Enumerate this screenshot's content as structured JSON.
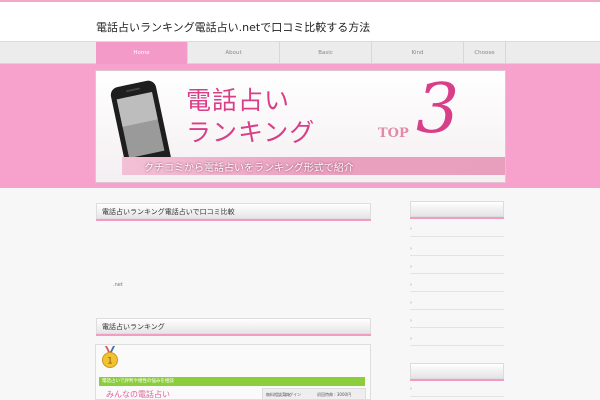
{
  "header": {
    "site_title": "電話占いランキング電話占い.netで口コミ比較する方法"
  },
  "nav": {
    "items": [
      {
        "label": "Home",
        "active": true
      },
      {
        "label": "About",
        "active": false
      },
      {
        "label": "Basic",
        "active": false
      },
      {
        "label": "Kind",
        "active": false
      },
      {
        "label": "Choose",
        "active": false
      }
    ]
  },
  "banner": {
    "title_line_1": "電話占い",
    "title_line_2": "ランキング",
    "top_label": "TOP",
    "top_number": "3",
    "subtitle": "クチコミから電話占いをランキング形式で紹介"
  },
  "main": {
    "section_1_title": "電話占いランキング電話占いで口コミ比較",
    "net_text": ".net",
    "section_2_title": "電話占いランキング",
    "ranking": {
      "green_bar_text": "電話占いで評判や相性の悩みを相談",
      "site_name": "みんなの電話占い",
      "detail_labels": [
        "無料相談案内",
        "ログイン",
        "初回特典 : 3000円"
      ]
    }
  },
  "colors": {
    "accent_pink": "#f7a2cc",
    "nav_active": "#f49ac8",
    "brand_magenta": "#d93f89",
    "green": "#8ccd3e"
  }
}
